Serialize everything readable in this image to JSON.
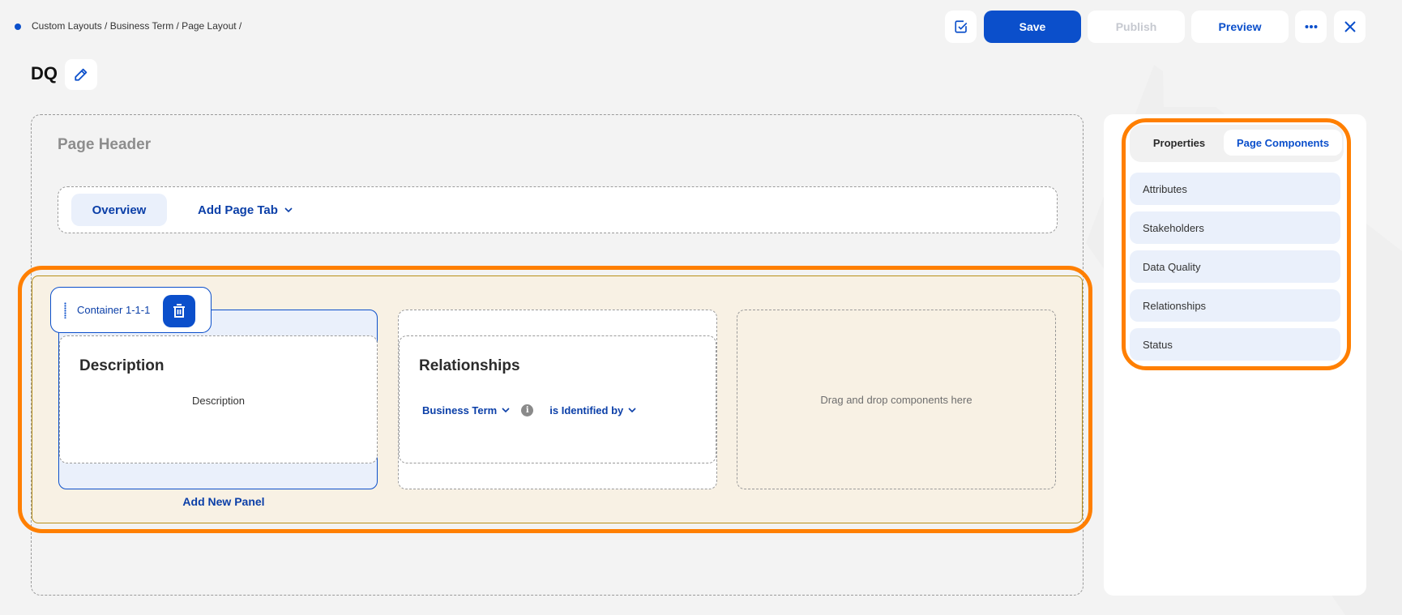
{
  "breadcrumb": "Custom Layouts / Business Term / Page Layout /",
  "page_title": "DQ",
  "toolbar": {
    "check_icon": "checkbox-check-icon",
    "save_label": "Save",
    "publish_label": "Publish",
    "preview_label": "Preview",
    "more_icon": "more-horizontal-icon",
    "close_icon": "close-icon"
  },
  "canvas": {
    "header_label": "Page Header",
    "tabs": [
      {
        "label": "Overview",
        "active": true
      }
    ],
    "add_tab_label": "Add Page Tab",
    "container": {
      "label": "Container 1-1-1",
      "add_panel_label": "Add New Panel",
      "columns": [
        {
          "panel_title": "Description",
          "panel_body": "Description"
        },
        {
          "panel_title": "Relationships",
          "relation": {
            "source": "Business Term",
            "relation": "is Identified by"
          }
        },
        {
          "placeholder": "Drag and drop components here"
        }
      ]
    }
  },
  "sidebar": {
    "tabs": [
      {
        "label": "Properties",
        "active": false
      },
      {
        "label": "Page Components",
        "active": true
      }
    ],
    "components": [
      {
        "label": "Attributes"
      },
      {
        "label": "Stakeholders"
      },
      {
        "label": "Data Quality"
      },
      {
        "label": "Relationships"
      },
      {
        "label": "Status"
      }
    ]
  },
  "colors": {
    "accent": "#0b4fcb",
    "highlight": "#ff7f00",
    "section_bg": "#f8f1e4",
    "item_bg": "#eaf0fb"
  }
}
